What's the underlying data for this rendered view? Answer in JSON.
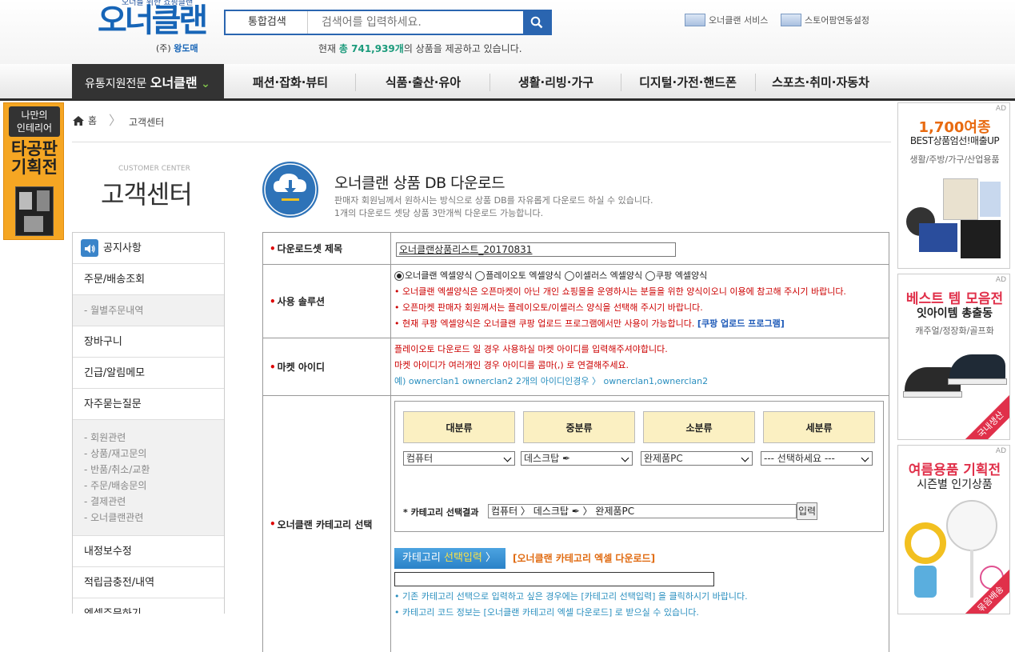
{
  "header": {
    "logo_tagline": "오너를 위한 쇼핑클랜",
    "logo_text": "오너클랜",
    "logo_sub_prefix": "(주)",
    "logo_sub_brand": "왕도매",
    "search_scope": "통합검색",
    "search_placeholder": "검색어를 입력하세요.",
    "count_prefix": "현재 ",
    "count_value": "총 741,939개",
    "count_suffix": "의 상품을 제공하고 있습니다.",
    "links": [
      "오너클랜 서비스",
      "스토어팜연동설정"
    ]
  },
  "nav": {
    "brand_prefix": "유통지원전문",
    "brand_name": "오너클랜",
    "brand_chevron": "⌄",
    "items": [
      "패션·잡화·뷰티",
      "식품·출산·유아",
      "생활·리빙·가구",
      "디지털·가전·핸드폰",
      "스포츠·취미·자동차"
    ]
  },
  "left_ad": {
    "line1": "나만의",
    "line2": "인테리어",
    "line3": "타공판",
    "line4": "기획전"
  },
  "breadcrumb": {
    "home": "홈",
    "separator": "〉",
    "current": "고객센터"
  },
  "sidebar": {
    "title_en": "CUSTOMER CENTER",
    "title": "고객센터",
    "items": [
      {
        "label": "공지사항"
      },
      {
        "label": "주문/배송조회"
      },
      {
        "label": "- 월별주문내역"
      },
      {
        "label": "장바구니"
      },
      {
        "label": "긴급/알림메모"
      },
      {
        "label": "자주묻는질문"
      }
    ],
    "sub_group": [
      "- 회원관련",
      "- 상품/재고문의",
      "- 반품/취소/교환",
      "- 주문/배송문의",
      "- 결제관련",
      "- 오너클랜관련"
    ],
    "items2": [
      {
        "label": "내정보수정"
      },
      {
        "label": "적립금충전/내역"
      },
      {
        "label": "엑셀주문하기"
      }
    ]
  },
  "page": {
    "title": "오너클랜 상품 DB 다운로드",
    "desc1": "판매자 회원님께서 원하시는 방식으로 상품 DB를 자유롭게 다운로드 하실 수 있습니다.",
    "desc2": "1개의 다운로드 셋당 상품 3만개씩 다운로드 가능합니다."
  },
  "form": {
    "required_mark": "•",
    "download_set_label": "다운로드셋 제목",
    "download_set_value": "오너클랜상품리스트_20170831",
    "solution_label": "사용 솔루션",
    "solution_options": [
      "오너클랜 엑셀양식",
      "플레이오토 엑셀양식",
      "이셀러스 엑셀양식",
      "쿠팡 엑셀양식"
    ],
    "solution_selected": 0,
    "solution_notes": [
      "• 오너클랜 엑셀양식은 오픈마켓이 아닌 개인 쇼핑몰을 운영하시는 분들을 위한 양식이오니 이용에 참고해 주시기 바랍니다.",
      "• 오픈마켓 판매자 회원께서는 플레이오토/이셀러스 양식을 선택해 주시기 바랍니다.",
      "• 현재 쿠팡 엑셀양식은 오너클랜 쿠팡 업로드 프로그램에서만 사용이 가능합니다."
    ],
    "coupang_link": "[쿠팡 업로드 프로그램]",
    "market_label": "마켓 아이디",
    "market_notes": [
      "플레이오토 다운로드 일 경우 사용하실 마켓 아이디를 입력해주셔야합니다.",
      "마켓 아이디가 여러개인 경우 아이디를 콤마(,) 로 연결해주세요."
    ],
    "market_example": "예) ownerclan1 ownerclan2 2개의 아이디인경우 〉 ownerclan1,ownerclan2",
    "category_label": "오너클랜 카테고리 선택",
    "category_heads": [
      "대분류",
      "중분류",
      "소분류",
      "세분류"
    ],
    "category_selects": [
      "컴퓨터",
      "데스크탑 ✒",
      "완제품PC",
      "--- 선택하세요 ---"
    ],
    "category_result_label": "* 카테고리 선택결과",
    "category_result_value": "컴퓨터 〉 데스크탑 ✒ 〉 완제품PC",
    "category_result_btn": "입력",
    "category_select_btn_prefix": "카테고리 ",
    "category_select_btn_hl": "선택입력",
    "category_select_btn_arrow": " 〉",
    "category_excel_link": "[오너클랜 카테고리 엑셀 다운로드]",
    "category_notes": [
      "• 기존 카테고리 선택으로 입력하고 싶은 경우에는 [카테고리 선택입력] 을 클릭하시기 바랍니다.",
      "• 카테고리 코드 정보는 [오너클랜 카테고리 엑셀 다운로드] 로 받으실 수 있습니다."
    ]
  },
  "right_ads": [
    {
      "tag": "AD",
      "headline": "1,700여종",
      "sub": "BEST상품엄선!매출UP",
      "desc": "생활/주방/가구/산업용품"
    },
    {
      "tag": "AD",
      "headline": "베스트 템 모음전",
      "sub": "잇아이템 총출동",
      "desc": "캐주얼/정장화/골프화",
      "ribbon": "국내생산"
    },
    {
      "tag": "AD",
      "headline": "여름용품 기획전",
      "sub": "시즌별 인기상품",
      "ribbon": "묶음배송"
    }
  ],
  "colors": {
    "brand_blue": "#1765b7",
    "search_blue": "#2a65b0",
    "count_green": "#1c9b7c",
    "required_red": "#cc0000",
    "category_head_bg": "#fbf0c2",
    "excel_orange": "#e06a10",
    "note_teal": "#2a8fbf",
    "left_ad_bg": "#f5a623"
  }
}
